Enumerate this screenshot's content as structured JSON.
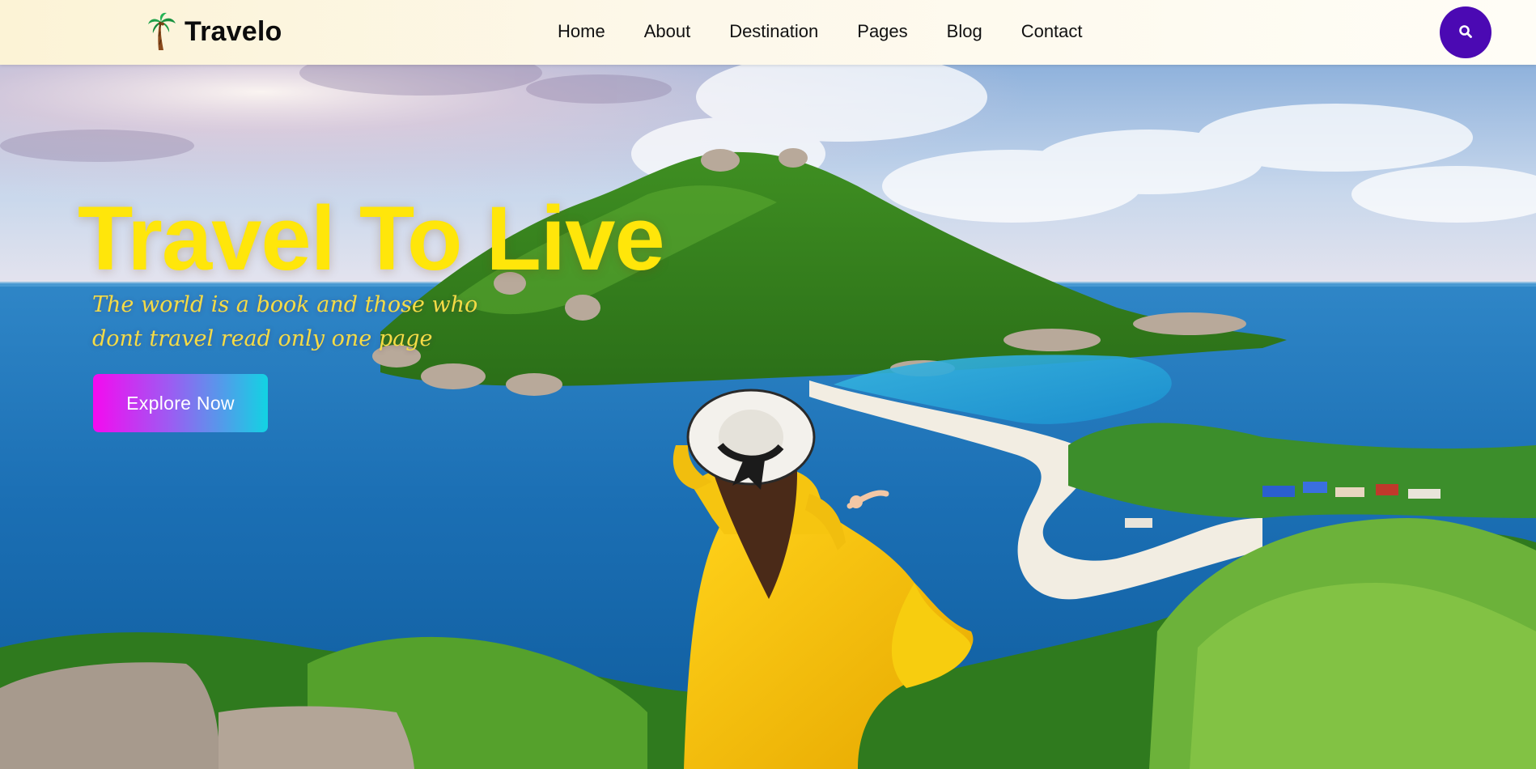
{
  "brand": {
    "name": "Travelo",
    "logo_icon": "palm-tree-icon"
  },
  "nav": {
    "items": [
      {
        "label": "Home"
      },
      {
        "label": "About"
      },
      {
        "label": "Destination"
      },
      {
        "label": "Pages"
      },
      {
        "label": "Blog"
      },
      {
        "label": "Contact"
      }
    ]
  },
  "search": {
    "icon": "search-icon",
    "color": "#4b09b3"
  },
  "hero": {
    "title": "Travel To Live",
    "tagline": "The world is a book and those who dont travel read only one page",
    "cta_label": "Explore Now",
    "title_color": "#ffe60a",
    "cta_gradient": [
      "#f50af0",
      "#12d3e3"
    ]
  }
}
